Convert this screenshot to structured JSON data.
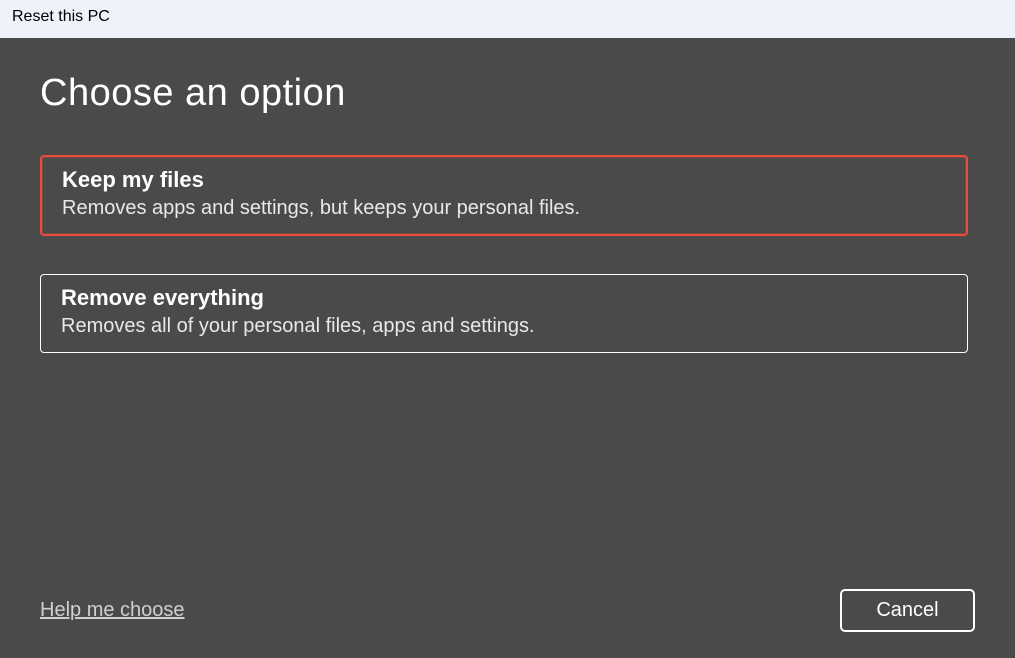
{
  "window": {
    "title": "Reset this PC"
  },
  "page": {
    "heading": "Choose an option"
  },
  "options": [
    {
      "title": "Keep my files",
      "description": "Removes apps and settings, but keeps your personal files.",
      "selected": true
    },
    {
      "title": "Remove everything",
      "description": "Removes all of your personal files, apps and settings.",
      "selected": false
    }
  ],
  "footer": {
    "help_link": "Help me choose",
    "cancel_label": "Cancel"
  }
}
